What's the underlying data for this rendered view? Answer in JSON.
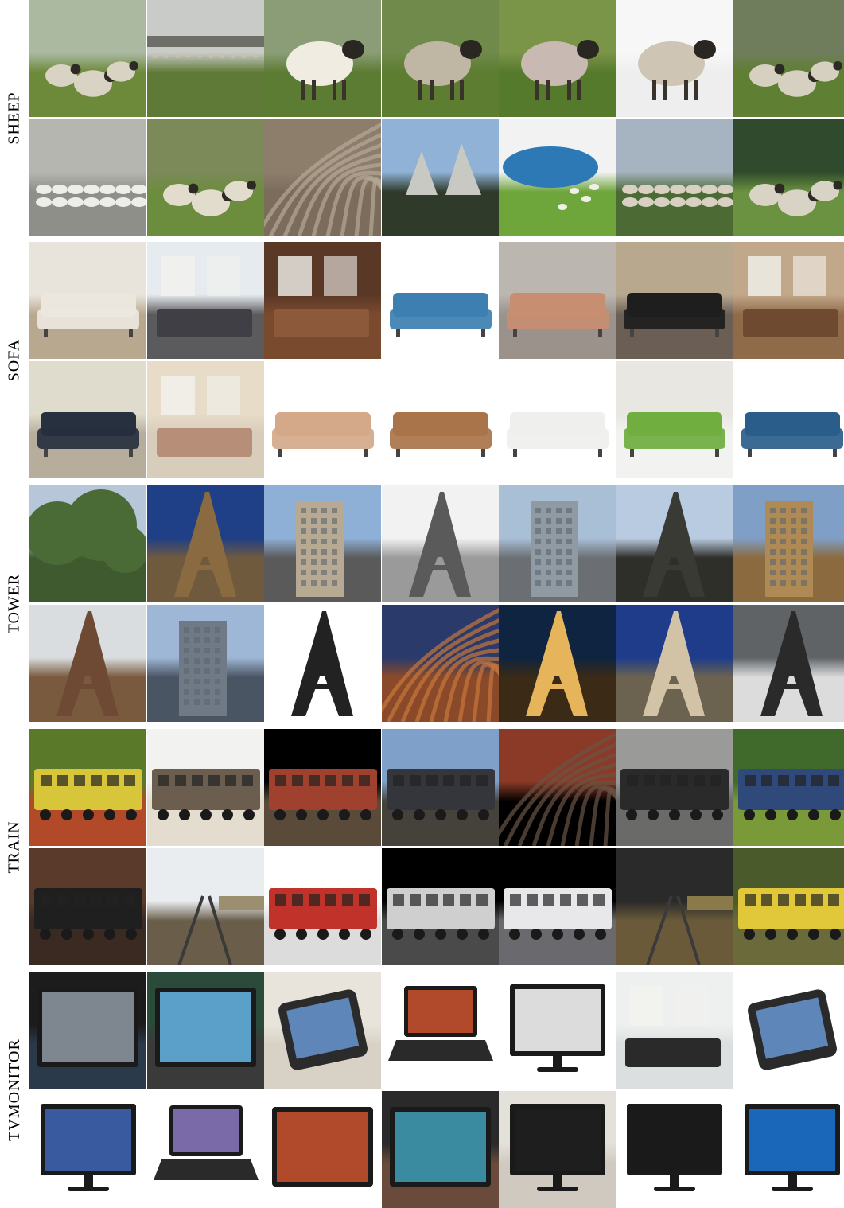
{
  "categories": [
    {
      "label": "SHEEP",
      "tiles": [
        {
          "name": "sheep-1-1",
          "sky": "#aab9a0",
          "ground": "#6c8a3a",
          "subject": "#d9d3c4",
          "shape": "group"
        },
        {
          "name": "sheep-1-2",
          "sky": "#c9cbc8",
          "ground": "#5f7a36",
          "subject": "#c7c0b0",
          "shape": "field"
        },
        {
          "name": "sheep-1-3",
          "sky": "#8a9d76",
          "ground": "#5c7b33",
          "subject": "#f0ece2",
          "shape": "animal"
        },
        {
          "name": "sheep-1-4",
          "sky": "#6f8a4a",
          "ground": "#5d7d31",
          "subject": "#bfb6a3",
          "shape": "animal"
        },
        {
          "name": "sheep-1-5",
          "sky": "#7a9448",
          "ground": "#567a2c",
          "subject": "#c8b9b2",
          "shape": "animal"
        },
        {
          "name": "sheep-1-6",
          "sky": "#f7f7f7",
          "ground": "#eeeeee",
          "subject": "#cfc5b4",
          "shape": "animal"
        },
        {
          "name": "sheep-1-7",
          "sky": "#6f7d5c",
          "ground": "#5f7f32",
          "subject": "#d6d0c0",
          "shape": "group"
        },
        {
          "name": "sheep-2-1",
          "sky": "#b6b6b0",
          "ground": "#8f8f8a",
          "subject": "#ededea",
          "shape": "flock"
        },
        {
          "name": "sheep-2-2",
          "sky": "#7c8a5a",
          "ground": "#6c8c3e",
          "subject": "#e2dccd",
          "shape": "group"
        },
        {
          "name": "sheep-2-3",
          "sky": "#8d7e6c",
          "ground": "#7b6c5c",
          "subject": "#b6a897",
          "shape": "texture"
        },
        {
          "name": "sheep-2-4",
          "sky": "#8fb2d6",
          "ground": "#2f3a2a",
          "subject": "#c8c9c2",
          "shape": "rocks"
        },
        {
          "name": "sheep-2-5",
          "sky": "#f2f2f2",
          "ground": "#6fa63c",
          "subject": "#2c79b6",
          "shape": "lake"
        },
        {
          "name": "sheep-2-6",
          "sky": "#a6b3c0",
          "ground": "#4c6a34",
          "subject": "#d8d1c3",
          "shape": "flock"
        },
        {
          "name": "sheep-2-7",
          "sky": "#2f4a2c",
          "ground": "#6a9240",
          "subject": "#d9d3c5",
          "shape": "group"
        }
      ]
    },
    {
      "label": "SOFA",
      "tiles": [
        {
          "name": "sofa-1-1",
          "sky": "#e8e4dc",
          "ground": "#b9a890",
          "subject": "#ece7de",
          "shape": "sofa"
        },
        {
          "name": "sofa-1-2",
          "sky": "#e6ebef",
          "ground": "#5b5a5c",
          "subject": "#3f3f45",
          "shape": "room"
        },
        {
          "name": "sofa-1-3",
          "sky": "#5a3826",
          "ground": "#7a4a2e",
          "subject": "#8c5a3a",
          "shape": "room"
        },
        {
          "name": "sofa-1-4",
          "sky": "#ffffff",
          "ground": "#ffffff",
          "subject": "#3d7fb0",
          "shape": "sofa"
        },
        {
          "name": "sofa-1-5",
          "sky": "#bcb6b1",
          "ground": "#9a928b",
          "subject": "#c78e72",
          "shape": "sofa"
        },
        {
          "name": "sofa-1-6",
          "sky": "#b7a88e",
          "ground": "#6b5f55",
          "subject": "#1e1e1e",
          "shape": "sofa"
        },
        {
          "name": "sofa-1-7",
          "sky": "#c2a88a",
          "ground": "#8f6b4a",
          "subject": "#6e4a30",
          "shape": "room"
        },
        {
          "name": "sofa-2-1",
          "sky": "#e0dccd",
          "ground": "#b6ad9c",
          "subject": "#27303f",
          "shape": "sofa"
        },
        {
          "name": "sofa-2-2",
          "sky": "#e7dcc8",
          "ground": "#d8cdbb",
          "subject": "#b78f78",
          "shape": "room"
        },
        {
          "name": "sofa-2-3",
          "sky": "#ffffff",
          "ground": "#ffffff",
          "subject": "#d4a98a",
          "shape": "sofa"
        },
        {
          "name": "sofa-2-4",
          "sky": "#ffffff",
          "ground": "#ffffff",
          "subject": "#a9744a",
          "shape": "sofa"
        },
        {
          "name": "sofa-2-5",
          "sky": "#ffffff",
          "ground": "#ffffff",
          "subject": "#efefed",
          "shape": "sofa"
        },
        {
          "name": "sofa-2-6",
          "sky": "#e9e7e2",
          "ground": "#f2f2f0",
          "subject": "#6fae3f",
          "shape": "sofa"
        },
        {
          "name": "sofa-2-7",
          "sky": "#ffffff",
          "ground": "#ffffff",
          "subject": "#2a5d8a",
          "shape": "sofa"
        }
      ]
    },
    {
      "label": "TOWER",
      "tiles": [
        {
          "name": "tower-1-1",
          "sky": "#b7c6d8",
          "ground": "#3e5a2e",
          "subject": "#4a6b36",
          "shape": "trees"
        },
        {
          "name": "tower-1-2",
          "sky": "#1f3f86",
          "ground": "#6f5a3e",
          "subject": "#8a6a40",
          "shape": "tower"
        },
        {
          "name": "tower-1-3",
          "sky": "#8fb0d6",
          "ground": "#5a5a5a",
          "subject": "#b8aa92",
          "shape": "building"
        },
        {
          "name": "tower-1-4",
          "sky": "#f2f2f2",
          "ground": "#9a9a9a",
          "subject": "#5a5a5a",
          "shape": "tower"
        },
        {
          "name": "tower-1-5",
          "sky": "#a9bfd6",
          "ground": "#6b6f74",
          "subject": "#8f9aa3",
          "shape": "building"
        },
        {
          "name": "tower-1-6",
          "sky": "#b9cbe0",
          "ground": "#2f2f2a",
          "subject": "#3a3a34",
          "shape": "tower"
        },
        {
          "name": "tower-1-7",
          "sky": "#7f9fc6",
          "ground": "#8a6a3e",
          "subject": "#b08a55",
          "shape": "building"
        },
        {
          "name": "tower-2-1",
          "sky": "#d9dde0",
          "ground": "#7a5a3e",
          "subject": "#6e4a34",
          "shape": "tower"
        },
        {
          "name": "tower-2-2",
          "sky": "#9fb7d6",
          "ground": "#4a5564",
          "subject": "#6f7a86",
          "shape": "building"
        },
        {
          "name": "tower-2-3",
          "sky": "#ffffff",
          "ground": "#ffffff",
          "subject": "#222222",
          "shape": "tower"
        },
        {
          "name": "tower-2-4",
          "sky": "#2a3a6a",
          "ground": "#8a4a2a",
          "subject": "#c8763a",
          "shape": "texture"
        },
        {
          "name": "tower-2-5",
          "sky": "#0e2440",
          "ground": "#3a2a16",
          "subject": "#e6b45a",
          "shape": "tower"
        },
        {
          "name": "tower-2-6",
          "sky": "#1e3c8a",
          "ground": "#6b6250",
          "subject": "#d2c3a6",
          "shape": "tower"
        },
        {
          "name": "tower-2-7",
          "sky": "#5f6366",
          "ground": "#dcdcdc",
          "subject": "#2a2a2a",
          "shape": "tower"
        }
      ]
    },
    {
      "label": "TRAIN",
      "tiles": [
        {
          "name": "train-1-1",
          "sky": "#5a7a2a",
          "ground": "#b24a2a",
          "subject": "#d7c53a",
          "shape": "train"
        },
        {
          "name": "train-1-2",
          "sky": "#f2f2f0",
          "ground": "#e4ddcf",
          "subject": "#6b5e4f",
          "shape": "train"
        },
        {
          "name": "train-1-3",
          "sky": "#000000",
          "ground": "#5a4a3a",
          "subject": "#a0402e",
          "shape": "train"
        },
        {
          "name": "train-1-4",
          "sky": "#7fa0c8",
          "ground": "#45423c",
          "subject": "#34363c",
          "shape": "train"
        },
        {
          "name": "train-1-5",
          "sky": "#8a3a26",
          "ground": "#000000",
          "subject": "#6a5446",
          "shape": "texture"
        },
        {
          "name": "train-1-6",
          "sky": "#9a9a98",
          "ground": "#6a6a68",
          "subject": "#2a2a2a",
          "shape": "train"
        },
        {
          "name": "train-1-7",
          "sky": "#3f6a2c",
          "ground": "#7a9a3a",
          "subject": "#2f4a7a",
          "shape": "train"
        },
        {
          "name": "train-2-1",
          "sky": "#5a3a2a",
          "ground": "#3a2a22",
          "subject": "#1f1f1f",
          "shape": "train"
        },
        {
          "name": "train-2-2",
          "sky": "#e9edf0",
          "ground": "#6a5e4a",
          "subject": "#9c8f70",
          "shape": "rails"
        },
        {
          "name": "train-2-3",
          "sky": "#ffffff",
          "ground": "#dcdcdc",
          "subject": "#c0322a",
          "shape": "train"
        },
        {
          "name": "train-2-4",
          "sky": "#000000",
          "ground": "#4a4a4a",
          "subject": "#cfcfcf",
          "shape": "train"
        },
        {
          "name": "train-2-5",
          "sky": "#000000",
          "ground": "#6a6a6e",
          "subject": "#e8e8ea",
          "shape": "train"
        },
        {
          "name": "train-2-6",
          "sky": "#2a2a2a",
          "ground": "#6a5a3a",
          "subject": "#8a7a4a",
          "shape": "rails"
        },
        {
          "name": "train-2-7",
          "sky": "#4a5a2a",
          "ground": "#6a6a3a",
          "subject": "#e0c83a",
          "shape": "train"
        }
      ]
    },
    {
      "label": "TVMONITOR",
      "tiles": [
        {
          "name": "tvmonitor-1-1",
          "sky": "#1c1c1c",
          "ground": "#2a3a4a",
          "subject": "#7e8790",
          "shape": "screen"
        },
        {
          "name": "tvmonitor-1-2",
          "sky": "#2a4a3a",
          "ground": "#3a3a3a",
          "subject": "#5aa0c8",
          "shape": "screen"
        },
        {
          "name": "tvmonitor-1-3",
          "sky": "#e8e4dc",
          "ground": "#d8d2c6",
          "subject": "#2b2b2b",
          "shape": "tablet"
        },
        {
          "name": "tvmonitor-1-4",
          "sky": "#ffffff",
          "ground": "#ffffff",
          "subject": "#b04a2a",
          "shape": "laptop"
        },
        {
          "name": "tvmonitor-1-5",
          "sky": "#ffffff",
          "ground": "#ffffff",
          "subject": "#dcdcdc",
          "shape": "monitor"
        },
        {
          "name": "tvmonitor-1-6",
          "sky": "#eef0f0",
          "ground": "#dcdfe0",
          "subject": "#2a2a2a",
          "shape": "room"
        },
        {
          "name": "tvmonitor-1-7",
          "sky": "#ffffff",
          "ground": "#ffffff",
          "subject": "#2a2a2a",
          "shape": "tablet"
        },
        {
          "name": "tvmonitor-2-1",
          "sky": "#ffffff",
          "ground": "#ffffff",
          "subject": "#3a5aa0",
          "shape": "monitor"
        },
        {
          "name": "tvmonitor-2-2",
          "sky": "#ffffff",
          "ground": "#ffffff",
          "subject": "#7a6aa8",
          "shape": "laptop"
        },
        {
          "name": "tvmonitor-2-3",
          "sky": "#ffffff",
          "ground": "#ffffff",
          "subject": "#b04a2a",
          "shape": "screen"
        },
        {
          "name": "tvmonitor-2-4",
          "sky": "#2a2a2a",
          "ground": "#6a4a3a",
          "subject": "#3a8aa0",
          "shape": "screen"
        },
        {
          "name": "tvmonitor-2-5",
          "sky": "#e4e0da",
          "ground": "#cfc9c0",
          "subject": "#1e1e1e",
          "shape": "monitor"
        },
        {
          "name": "tvmonitor-2-6",
          "sky": "#ffffff",
          "ground": "#ffffff",
          "subject": "#1a1a1a",
          "shape": "monitor"
        },
        {
          "name": "tvmonitor-2-7",
          "sky": "#ffffff",
          "ground": "#ffffff",
          "subject": "#1a66b8",
          "shape": "monitor"
        }
      ]
    }
  ]
}
